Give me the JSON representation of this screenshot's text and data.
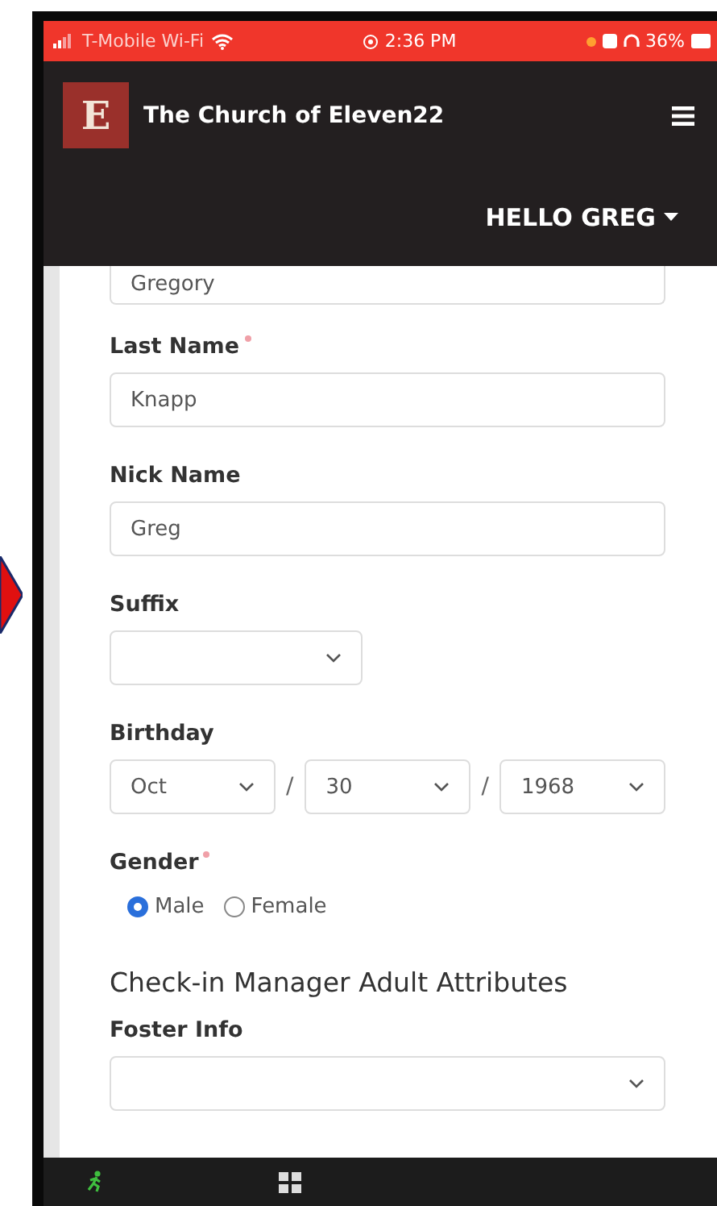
{
  "status_bar": {
    "carrier": "T-Mobile Wi-Fi",
    "time": "2:36 PM",
    "battery": "36%"
  },
  "header": {
    "logo": "E",
    "title": "The Church of Eleven22",
    "user_menu": "HELLO GREG"
  },
  "form": {
    "fields": [
      {
        "kind": "text",
        "value": "Gregory"
      },
      {
        "kind": "text",
        "label": "Last Name",
        "required": true,
        "value": "Knapp"
      },
      {
        "kind": "text",
        "label": "Nick Name",
        "required": false,
        "value": "Greg"
      },
      {
        "kind": "select",
        "label": "Suffix",
        "required": false
      },
      {
        "kind": "date",
        "label": "Birthday",
        "required": false,
        "parts": [
          "Oct",
          "30",
          "1968"
        ],
        "separator": "/"
      },
      {
        "kind": "radio",
        "label": "Gender",
        "required": true,
        "options": [
          {
            "label": "Male",
            "selected": true
          },
          {
            "label": "Female",
            "selected": false
          }
        ]
      },
      {
        "kind": "heading",
        "text": "Check-in Manager Adult Attributes"
      },
      {
        "kind": "select",
        "label": "Foster Info",
        "required": false
      }
    ]
  }
}
